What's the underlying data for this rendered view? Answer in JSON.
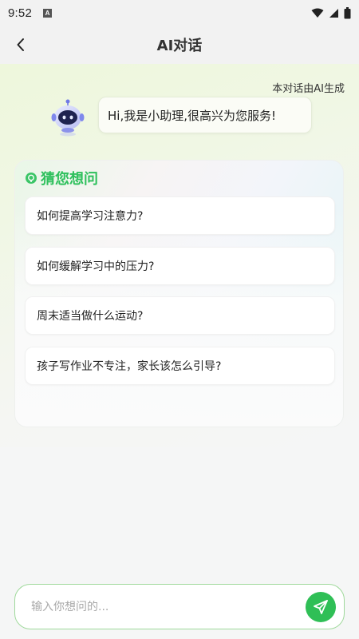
{
  "status_bar": {
    "time": "9:52",
    "notification_badge": "A"
  },
  "header": {
    "title": "AI对话",
    "back_icon": "chevron-left-icon"
  },
  "chat": {
    "ai_notice": "本对话由AI生成",
    "assistant_avatar": "robot-icon",
    "greeting": "Hi,我是小助理,很高兴为您服务!"
  },
  "suggestions": {
    "title": "猜您想问",
    "items": [
      {
        "label": "如何提高学习注意力?"
      },
      {
        "label": "如何缓解学习中的压力?"
      },
      {
        "label": "周末适当做什么运动?"
      },
      {
        "label": "孩子写作业不专注，家长该怎么引导?"
      }
    ]
  },
  "composer": {
    "placeholder": "输入你想问的...",
    "send_icon": "send-icon"
  },
  "colors": {
    "accent": "#2fbf56",
    "title_green": "#2ec05c",
    "input_border": "#9fd99b"
  }
}
